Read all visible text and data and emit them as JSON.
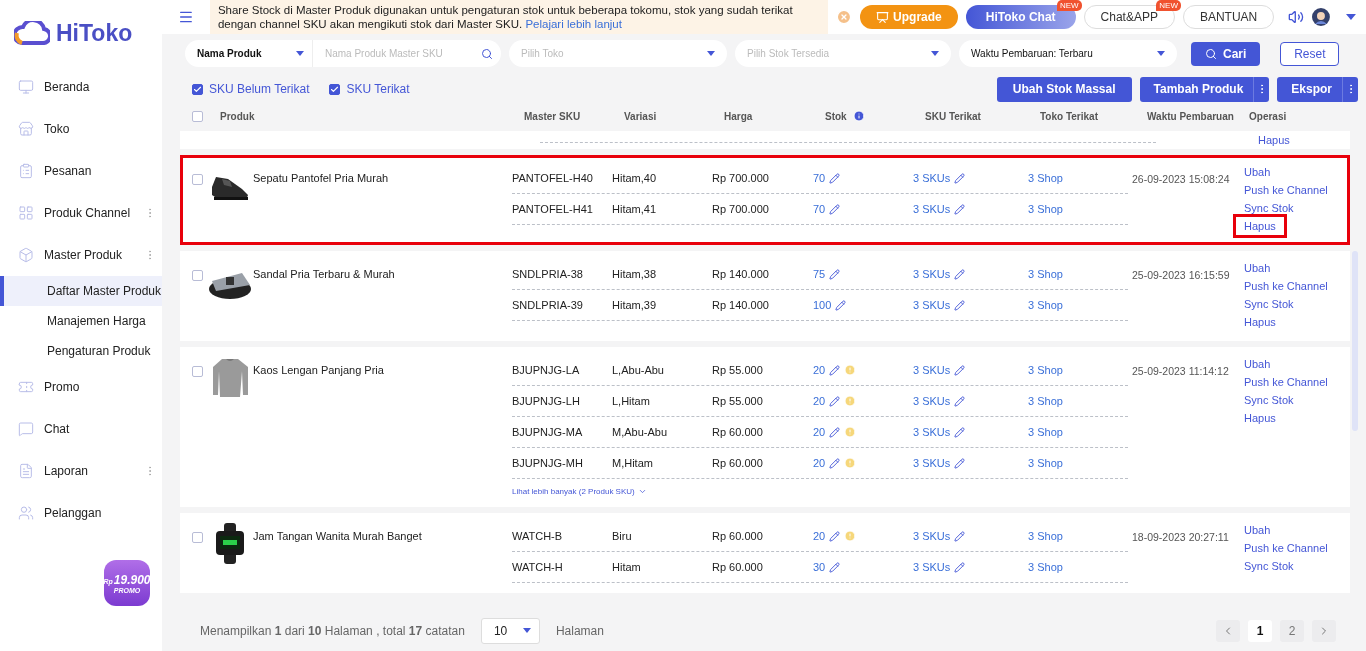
{
  "sidebar": {
    "logo": "HiToko",
    "items": [
      {
        "label": "Beranda",
        "expandable": false
      },
      {
        "label": "Toko",
        "expandable": false
      },
      {
        "label": "Pesanan",
        "expandable": false
      },
      {
        "label": "Produk Channel",
        "expandable": true
      },
      {
        "label": "Master Produk",
        "expandable": true,
        "children": [
          {
            "label": "Daftar Master Produk",
            "selected": true
          },
          {
            "label": "Manajemen Harga",
            "selected": false
          },
          {
            "label": "Pengaturan Produk",
            "selected": false
          }
        ]
      },
      {
        "label": "Promo",
        "expandable": false
      },
      {
        "label": "Chat",
        "expandable": false
      },
      {
        "label": "Laporan",
        "expandable": true
      },
      {
        "label": "Pelanggan",
        "expandable": false
      }
    ],
    "promo": {
      "currency": "Rp",
      "price": "19.900",
      "label": "PROMO"
    }
  },
  "topbar": {
    "notice": "Share Stock di Master Produk digunakan untuk pengaturan stok untuk beberapa tokomu, stok yang sudah terikat dengan channel SKU akan mengikuti stok dari Master SKU.",
    "notice_link": "Pelajari lebih lanjut",
    "buttons": [
      {
        "label": "Upgrade",
        "kind": "upgrade"
      },
      {
        "label": "HiToko Chat",
        "kind": "primary",
        "badge": "NEW"
      },
      {
        "label": "Chat&APP",
        "kind": "outline",
        "badge": "NEW"
      },
      {
        "label": "BANTUAN",
        "kind": "outline"
      }
    ]
  },
  "filters": {
    "field_select": "Nama Produk",
    "search": {
      "placeholder": "Nama Produk Master SKU"
    },
    "shop": {
      "placeholder": "Pilih Toko"
    },
    "stock": {
      "placeholder": "Pilih Stok Tersedia"
    },
    "sort": "Waktu Pembaruan: Terbaru",
    "search_button": "Cari",
    "reset_button": "Reset"
  },
  "toggles": [
    {
      "label": "SKU Belum Terikat",
      "checked": true
    },
    {
      "label": "SKU Terikat",
      "checked": true
    }
  ],
  "actions": [
    {
      "label": "Ubah Stok Massal",
      "more": false
    },
    {
      "label": "Tambah Produk",
      "more": true
    },
    {
      "label": "Ekspor",
      "more": true
    }
  ],
  "table": {
    "select_all": {
      "checked": false
    },
    "columns": [
      "Produk",
      "Master SKU",
      "Variasi",
      "Harga",
      "Stok",
      "SKU Terikat",
      "Toko Terikat",
      "Waktu Pembaruan",
      "Operasi"
    ],
    "partial_row": {
      "operations": [
        "Hapus"
      ]
    },
    "rows": [
      {
        "name": "Sepatu Pantofel Pria Murah",
        "checked": false,
        "highlighted": true,
        "updated": "26-09-2023 15:08:24",
        "variants": [
          {
            "sku": "PANTOFEL-H40",
            "variation": "Hitam,40",
            "price": "Rp 700.000",
            "stock": "70",
            "warning": false,
            "linked_sku": "3 SKUs",
            "linked_shop": "3 Shop"
          },
          {
            "sku": "PANTOFEL-H41",
            "variation": "Hitam,41",
            "price": "Rp 700.000",
            "stock": "70",
            "warning": false,
            "linked_sku": "3 SKUs",
            "linked_shop": "3 Shop"
          }
        ],
        "operations": [
          {
            "label": "Ubah",
            "highlighted": false
          },
          {
            "label": "Push ke Channel",
            "highlighted": false
          },
          {
            "label": "Sync Stok",
            "highlighted": false
          },
          {
            "label": "Hapus",
            "highlighted": true
          }
        ]
      },
      {
        "name": "Sandal Pria Terbaru & Murah",
        "checked": false,
        "highlighted": false,
        "updated": "25-09-2023 16:15:59",
        "variants": [
          {
            "sku": "SNDLPRIA-38",
            "variation": "Hitam,38",
            "price": "Rp 140.000",
            "stock": "75",
            "warning": false,
            "linked_sku": "3 SKUs",
            "linked_shop": "3 Shop"
          },
          {
            "sku": "SNDLPRIA-39",
            "variation": "Hitam,39",
            "price": "Rp 140.000",
            "stock": "100",
            "warning": false,
            "linked_sku": "3 SKUs",
            "linked_shop": "3 Shop"
          }
        ],
        "operations": [
          {
            "label": "Ubah",
            "highlighted": false
          },
          {
            "label": "Push ke Channel",
            "highlighted": false
          },
          {
            "label": "Sync Stok",
            "highlighted": false
          },
          {
            "label": "Hapus",
            "highlighted": false
          }
        ]
      },
      {
        "name": "Kaos Lengan Panjang Pria",
        "checked": false,
        "highlighted": false,
        "updated": "25-09-2023 11:14:12",
        "variants": [
          {
            "sku": "BJUPNJG-LA",
            "variation": "L,Abu-Abu",
            "price": "Rp 55.000",
            "stock": "20",
            "warning": true,
            "linked_sku": "3 SKUs",
            "linked_shop": "3 Shop"
          },
          {
            "sku": "BJUPNJG-LH",
            "variation": "L,Hitam",
            "price": "Rp 55.000",
            "stock": "20",
            "warning": true,
            "linked_sku": "3 SKUs",
            "linked_shop": "3 Shop"
          },
          {
            "sku": "BJUPNJG-MA",
            "variation": "M,Abu-Abu",
            "price": "Rp 60.000",
            "stock": "20",
            "warning": true,
            "linked_sku": "3 SKUs",
            "linked_shop": "3 Shop"
          },
          {
            "sku": "BJUPNJG-MH",
            "variation": "M,Hitam",
            "price": "Rp 60.000",
            "stock": "20",
            "warning": true,
            "linked_sku": "3 SKUs",
            "linked_shop": "3 Shop"
          }
        ],
        "more_link": "Lihat lebih banyak (2 Produk SKU)",
        "operations": [
          {
            "label": "Ubah",
            "highlighted": false
          },
          {
            "label": "Push ke Channel",
            "highlighted": false
          },
          {
            "label": "Sync Stok",
            "highlighted": false
          },
          {
            "label": "Hapus",
            "highlighted": false
          }
        ]
      },
      {
        "name": "Jam Tangan Wanita Murah Banget",
        "checked": false,
        "highlighted": false,
        "updated": "18-09-2023 20:27:11",
        "variants": [
          {
            "sku": "WATCH-B",
            "variation": "Biru",
            "price": "Rp 60.000",
            "stock": "20",
            "warning": true,
            "linked_sku": "3 SKUs",
            "linked_shop": "3 Shop"
          },
          {
            "sku": "WATCH-H",
            "variation": "Hitam",
            "price": "Rp 60.000",
            "stock": "30",
            "warning": false,
            "linked_sku": "3 SKUs",
            "linked_shop": "3 Shop"
          }
        ],
        "operations": [
          {
            "label": "Ubah",
            "highlighted": false
          },
          {
            "label": "Push ke Channel",
            "highlighted": false
          },
          {
            "label": "Sync Stok",
            "highlighted": false
          }
        ]
      }
    ]
  },
  "footer": {
    "summary": "Menampilkan **1** dari **10** Halaman , total **17** catatan",
    "page_size": "10",
    "page_size_label": "Halaman",
    "pages": [
      {
        "label": "1",
        "selected": true
      },
      {
        "label": "2",
        "selected": false
      }
    ]
  }
}
